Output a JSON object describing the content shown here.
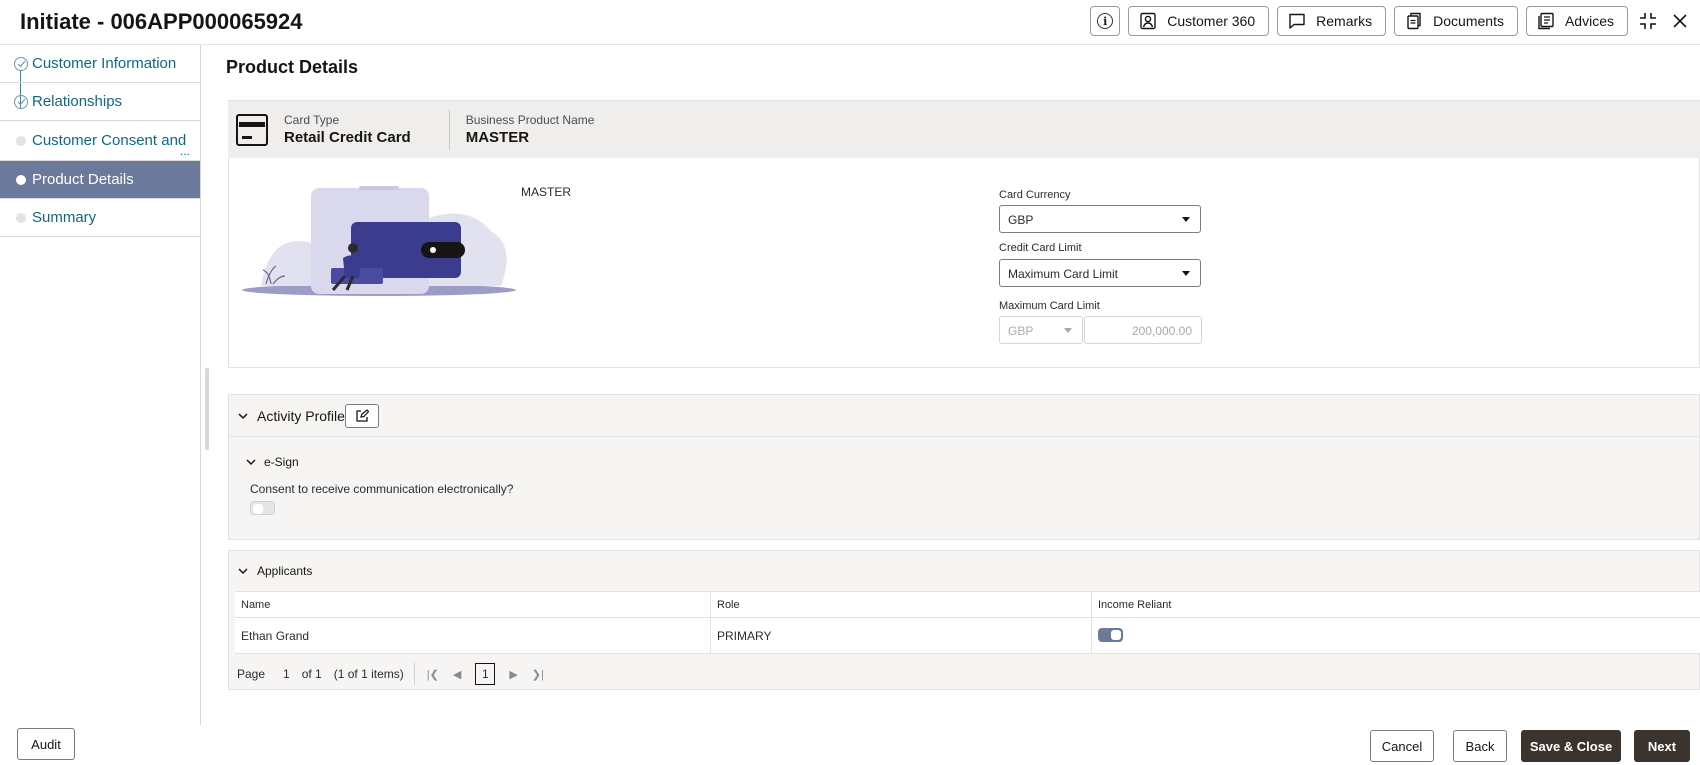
{
  "header": {
    "title": "Initiate - 006APP000065924",
    "buttons": {
      "customer360": "Customer 360",
      "remarks": "Remarks",
      "documents": "Documents",
      "advices": "Advices"
    }
  },
  "sidebar": {
    "steps": [
      {
        "label": "Customer Information",
        "state": "done"
      },
      {
        "label": "Relationships",
        "state": "done"
      },
      {
        "label": "Customer Consent and",
        "state": "pending",
        "more": "..."
      },
      {
        "label": "Product Details",
        "state": "active"
      },
      {
        "label": "Summary",
        "state": "pending"
      }
    ]
  },
  "main": {
    "title": "Product Details",
    "card_type_label": "Card Type",
    "card_type_value": "Retail Credit Card",
    "business_product_label": "Business Product Name",
    "business_product_value": "MASTER",
    "product_name": "MASTER",
    "card_currency_label": "Card Currency",
    "card_currency_value": "GBP",
    "credit_limit_label": "Credit Card Limit",
    "credit_limit_value": "Maximum Card Limit",
    "max_limit_label": "Maximum Card Limit",
    "max_limit_currency": "GBP",
    "max_limit_amount": "200,000.00"
  },
  "activity_profile": {
    "title": "Activity Profile",
    "esign_title": "e-Sign",
    "consent_label": "Consent to receive communication electronically?",
    "consent_on": false
  },
  "applicants": {
    "title": "Applicants",
    "columns": [
      "Name",
      "Role",
      "Income Reliant"
    ],
    "rows": [
      {
        "name": "Ethan Grand",
        "role": "PRIMARY",
        "income_reliant": true
      }
    ],
    "pager": {
      "page_label": "Page",
      "page_value": "1",
      "of_label": "of 1",
      "items_label": "(1 of 1 items)",
      "current": "1"
    }
  },
  "footer": {
    "audit": "Audit",
    "cancel": "Cancel",
    "back": "Back",
    "save_close": "Save & Close",
    "next": "Next"
  },
  "colors": {
    "active_step": "#6b7a9b",
    "link": "#0d6983",
    "primary_button": "#3b332d"
  }
}
